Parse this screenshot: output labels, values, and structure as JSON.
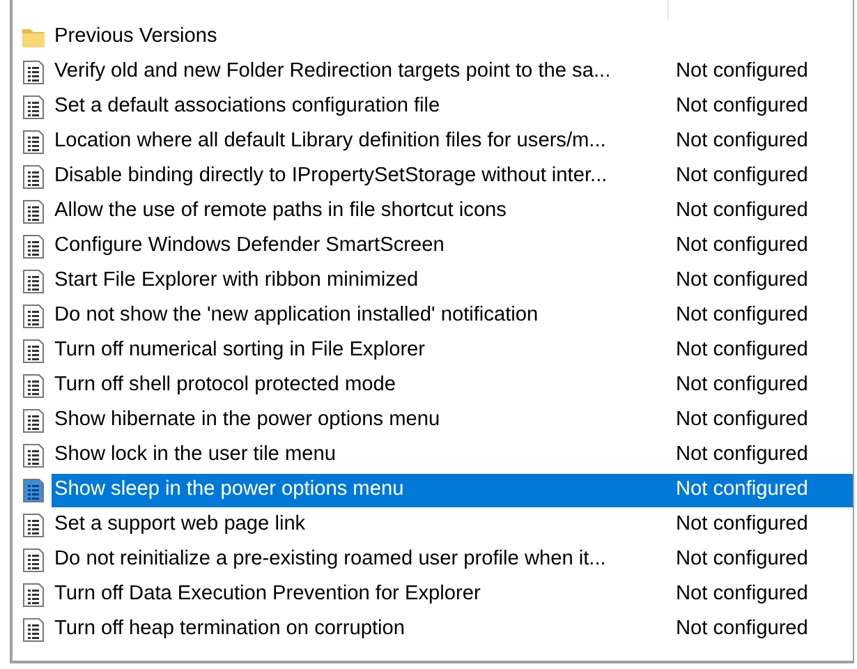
{
  "rows": [
    {
      "kind": "folder",
      "name": "Previous Versions",
      "selected": false
    },
    {
      "kind": "setting",
      "name": "Verify old and new Folder Redirection targets point to the sa...",
      "state": "Not configured",
      "selected": false
    },
    {
      "kind": "setting",
      "name": "Set a default associations configuration file",
      "state": "Not configured",
      "selected": false
    },
    {
      "kind": "setting",
      "name": "Location where all default Library definition files for users/m...",
      "state": "Not configured",
      "selected": false
    },
    {
      "kind": "setting",
      "name": "Disable binding directly to IPropertySetStorage without inter...",
      "state": "Not configured",
      "selected": false
    },
    {
      "kind": "setting",
      "name": "Allow the use of remote paths in file shortcut icons",
      "state": "Not configured",
      "selected": false
    },
    {
      "kind": "setting",
      "name": "Configure Windows Defender SmartScreen",
      "state": "Not configured",
      "selected": false
    },
    {
      "kind": "setting",
      "name": "Start File Explorer with ribbon minimized",
      "state": "Not configured",
      "selected": false
    },
    {
      "kind": "setting",
      "name": "Do not show the 'new application installed' notification",
      "state": "Not configured",
      "selected": false
    },
    {
      "kind": "setting",
      "name": "Turn off numerical sorting in File Explorer",
      "state": "Not configured",
      "selected": false
    },
    {
      "kind": "setting",
      "name": "Turn off shell protocol protected mode",
      "state": "Not configured",
      "selected": false
    },
    {
      "kind": "setting",
      "name": "Show hibernate in the power options menu",
      "state": "Not configured",
      "selected": false
    },
    {
      "kind": "setting",
      "name": "Show lock in the user tile menu",
      "state": "Not configured",
      "selected": false
    },
    {
      "kind": "setting",
      "name": "Show sleep in the power options menu",
      "state": "Not configured",
      "selected": true
    },
    {
      "kind": "setting",
      "name": "Set a support web page link",
      "state": "Not configured",
      "selected": false
    },
    {
      "kind": "setting",
      "name": "Do not reinitialize a pre-existing roamed user profile when it...",
      "state": "Not configured",
      "selected": false
    },
    {
      "kind": "setting",
      "name": "Turn off Data Execution Prevention for Explorer",
      "state": "Not configured",
      "selected": false
    },
    {
      "kind": "setting",
      "name": "Turn off heap termination on corruption",
      "state": "Not configured",
      "selected": false
    }
  ]
}
